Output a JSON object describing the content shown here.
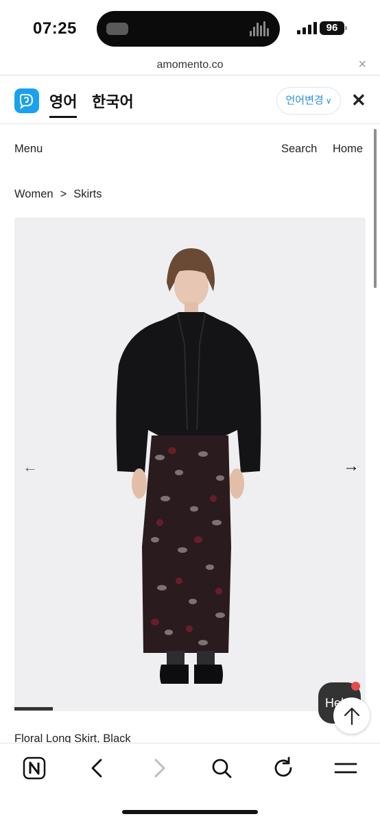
{
  "status": {
    "time": "07:25",
    "battery": "96"
  },
  "url_bar": {
    "domain": "amomento.co",
    "close_icon": "close-icon"
  },
  "language_bar": {
    "tabs": [
      {
        "label": "영어",
        "active": true
      },
      {
        "label": "한국어",
        "active": false
      }
    ],
    "change_label": "언어변경",
    "accent": "#1aa1ee"
  },
  "site_nav": {
    "menu_label": "Menu",
    "search_label": "Search",
    "home_label": "Home"
  },
  "breadcrumb": {
    "items": [
      "Women",
      "Skirts"
    ],
    "separator": ">"
  },
  "product": {
    "title": "Floral Long Skirt, Black",
    "image_icon": "model-photo",
    "slide_progress": 0.11
  },
  "help": {
    "label": "Help"
  },
  "toolbar": {
    "icons": [
      "naver-home-icon",
      "back-icon",
      "forward-icon",
      "search-icon",
      "reload-icon",
      "menu-icon"
    ]
  }
}
